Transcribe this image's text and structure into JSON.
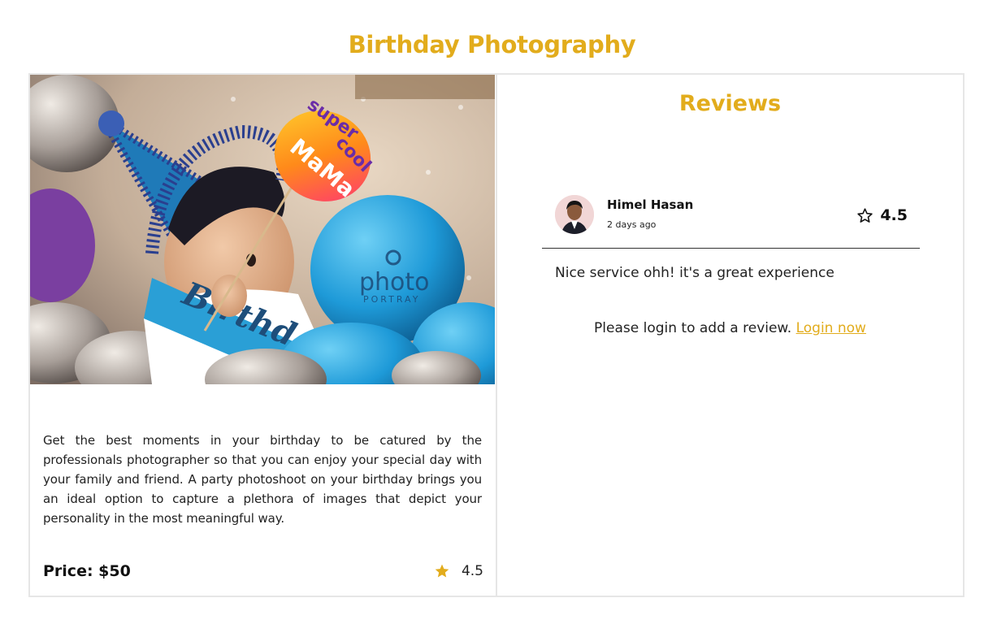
{
  "page": {
    "title": "Birthday Photography"
  },
  "service": {
    "image_alt": "Toddler in blue party hat with balloons",
    "image_overlay_lines": [
      "super",
      "cool",
      "MaMa"
    ],
    "watermark_text": "photo",
    "watermark_sub": "PORTRAY",
    "sash_text": "Birthd",
    "description": "Get the best moments in your birthday to be catured by the professionals photographer so that you can enjoy your special day with your family and friend. A party photoshoot on your birthday brings you an ideal option to capture a plethora of images that depict your personality in the most meaningful way.",
    "price_label": "Price: $50",
    "rating": "4.5",
    "star_icon": "star-filled-icon"
  },
  "reviews": {
    "title": "Reviews",
    "items": [
      {
        "name": "Himel Hasan",
        "time": "2 days ago",
        "rating": "4.5",
        "text": "Nice service ohh! it's a great experience",
        "star_icon": "star-outline-icon"
      }
    ],
    "login_prompt": "Please login to add a review.",
    "login_link": "Login now"
  },
  "colors": {
    "accent": "#e2ac1c",
    "border": "#e6e6e6"
  }
}
